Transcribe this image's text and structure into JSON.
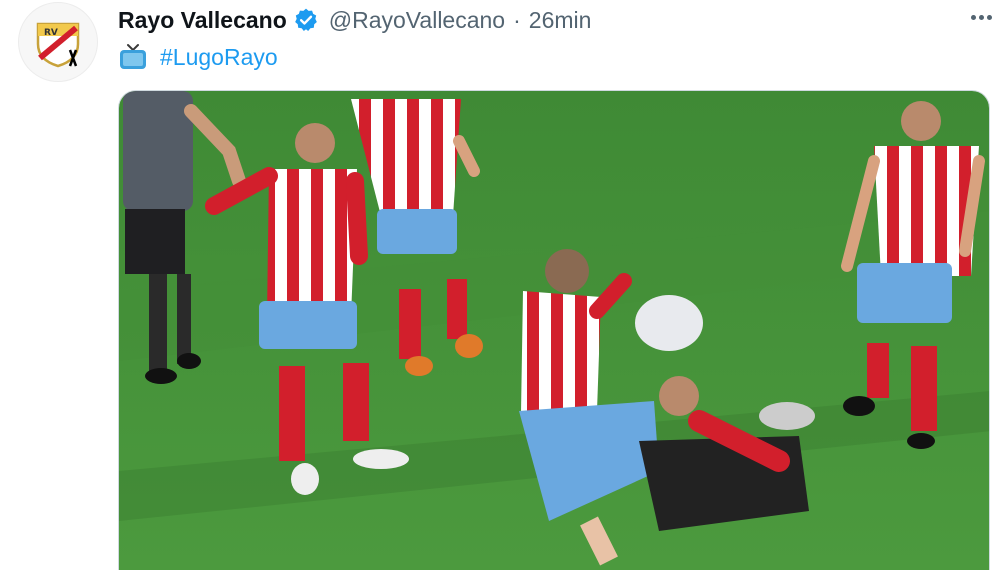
{
  "tweet": {
    "author_name": "Rayo Vallecano",
    "handle": "@RayoVallecano",
    "separator": "·",
    "timestamp": "26min",
    "hashtag": "#LugoRayo"
  },
  "colors": {
    "hashtag": "#1d9bf0",
    "verified": "#1d9bf0",
    "pitch": "#4a8a3a",
    "kit_red": "#d21f2c"
  },
  "icons": [
    "verified-badge-icon",
    "more-options-icon",
    "tv-icon"
  ]
}
